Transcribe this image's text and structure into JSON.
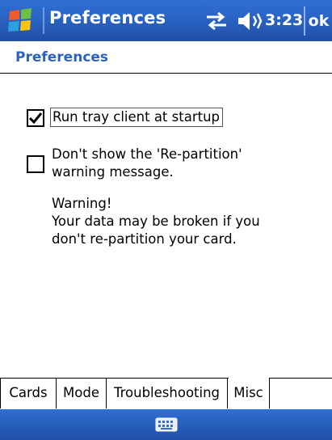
{
  "titlebar": {
    "title": "Preferences",
    "clock": "3:23",
    "ok_label": "ok",
    "icons": [
      "windows-start-icon",
      "connectivity-icon",
      "speaker-icon"
    ]
  },
  "page": {
    "title": "Preferences"
  },
  "options": {
    "run_tray": {
      "label": "Run tray client at startup",
      "checked": true
    },
    "repartition_warning": {
      "label": "Don't show the 'Re-partition' warning message.",
      "checked": false
    }
  },
  "warning": {
    "heading": "Warning!",
    "body": "Your data may be broken if you don't re-partition your card."
  },
  "tabs": [
    {
      "label": "Cards"
    },
    {
      "label": "Mode"
    },
    {
      "label": "Troubleshooting"
    },
    {
      "label": "Misc",
      "active": true
    }
  ],
  "bottombar": {
    "icon": "keyboard-icon"
  },
  "colors": {
    "accent": "#2b62c4",
    "bar": "#2a63c4"
  }
}
